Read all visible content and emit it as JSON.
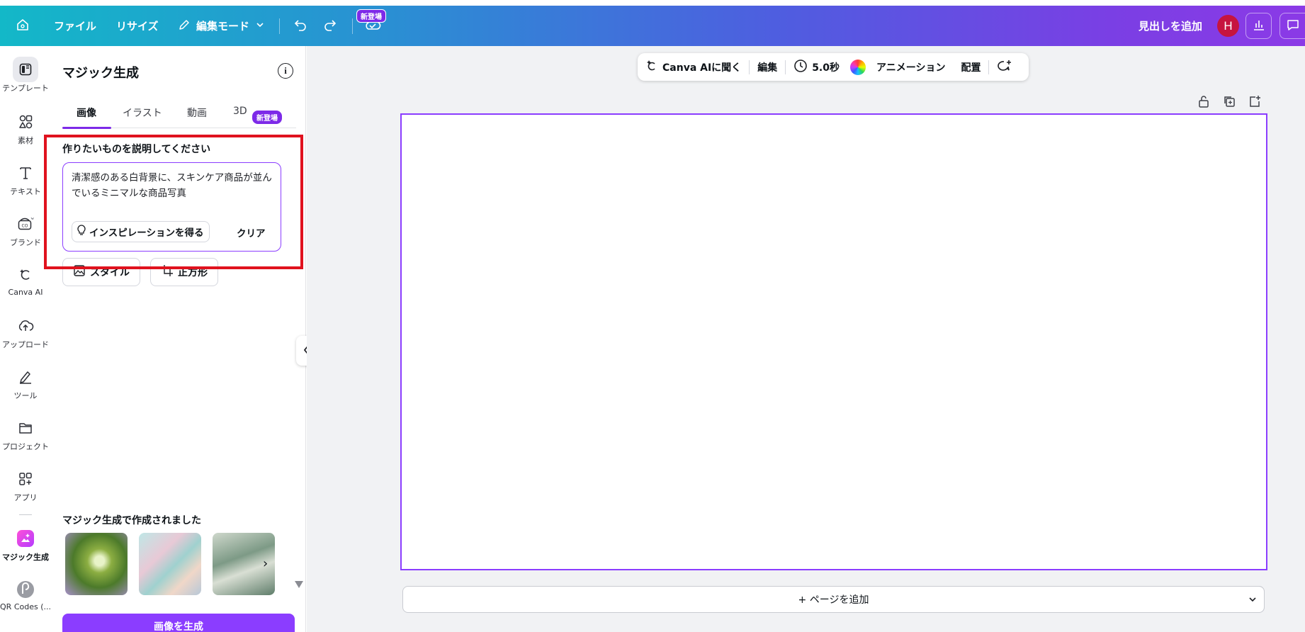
{
  "topbar": {
    "home_icon": "home-icon",
    "file": "ファイル",
    "resize": "リサイズ",
    "edit_mode": "編集モード",
    "new_badge": "新登場",
    "add_heading": "見出しを追加",
    "avatar_initial": "H"
  },
  "rail": {
    "items": [
      {
        "label": "テンプレート",
        "icon": "template-icon"
      },
      {
        "label": "素材",
        "icon": "elements-icon"
      },
      {
        "label": "テキスト",
        "icon": "text-icon"
      },
      {
        "label": "ブランド",
        "icon": "brand-icon"
      },
      {
        "label": "Canva AI",
        "icon": "canva-ai-icon"
      },
      {
        "label": "アップロード",
        "icon": "upload-icon"
      },
      {
        "label": "ツール",
        "icon": "tools-icon"
      },
      {
        "label": "プロジェクト",
        "icon": "folder-icon"
      },
      {
        "label": "アプリ",
        "icon": "apps-icon"
      },
      {
        "label": "マジック生成",
        "icon": "magic-media-icon"
      },
      {
        "label": "QR Codes (...",
        "icon": "qr-codes-icon"
      }
    ]
  },
  "panel": {
    "title": "マジック生成",
    "tabs": [
      "画像",
      "イラスト",
      "動画",
      "3D"
    ],
    "tab_badge": "新登場",
    "prompt_label": "作りたいものを説明してください",
    "prompt_value": "清潔感のある白背景に、スキンケア商品が並んでいるミニマルな商品写真",
    "inspiration": "インスピレーションを得る",
    "clear": "クリア",
    "style": "スタイル",
    "aspect": "正方形",
    "made_with": "マジック生成で作成されました",
    "generate": "画像を生成"
  },
  "context_toolbar": {
    "ask_ai": "Canva AIに聞く",
    "edit": "編集",
    "duration": "5.0秒",
    "animation": "アニメーション",
    "position": "配置"
  },
  "canvas": {
    "add_page": "+ ページを追加"
  },
  "colors": {
    "accent": "#8b3dff",
    "highlight": "#e0121e",
    "avatar": "#c6143f"
  }
}
